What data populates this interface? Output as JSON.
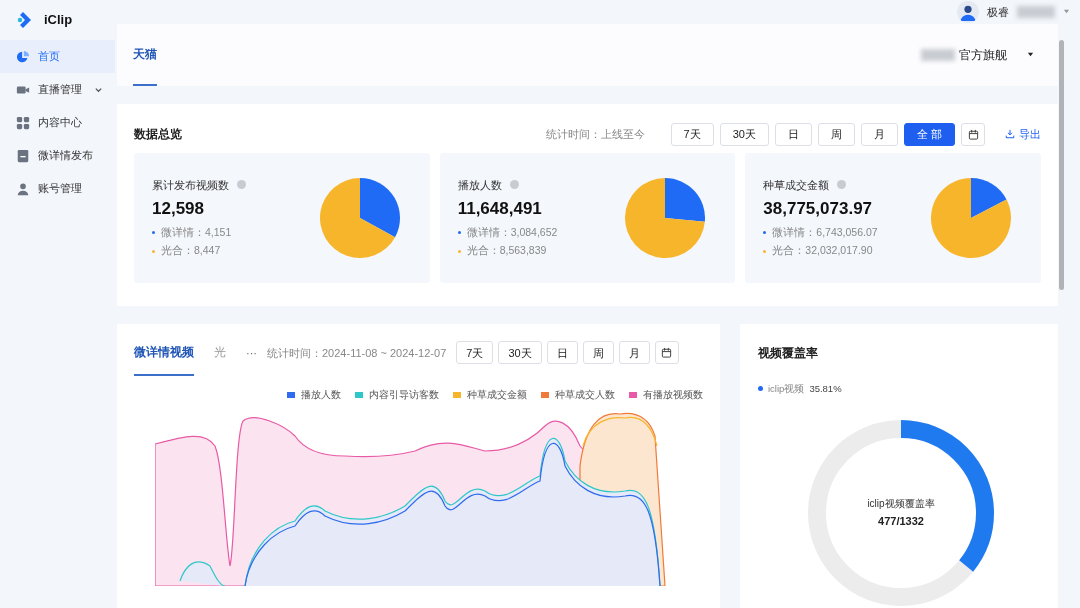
{
  "app": {
    "name": "iClip"
  },
  "user": {
    "name": "极睿"
  },
  "sidebar": {
    "items": [
      {
        "label": "首页",
        "selected": true
      },
      {
        "label": "直播管理",
        "selected": false,
        "expanded": false
      },
      {
        "label": "内容中心",
        "selected": false
      },
      {
        "label": "微详情发布",
        "selected": false
      },
      {
        "label": "账号管理",
        "selected": false
      }
    ]
  },
  "platform_tabs": [
    {
      "label": "天猫",
      "selected": true
    }
  ],
  "store_select": {
    "value": "官方旗舰"
  },
  "overview": {
    "title": "数据总览",
    "stat_time": "统计时间：上线至今",
    "ranges": [
      {
        "label": "7天",
        "selected": false
      },
      {
        "label": "30天",
        "selected": false
      },
      {
        "label": "日",
        "selected": false
      },
      {
        "label": "周",
        "selected": false
      },
      {
        "label": "月",
        "selected": false
      },
      {
        "label": "全 部",
        "selected": true
      }
    ],
    "export": "导出",
    "cards": [
      {
        "title": "累计发布视频数",
        "total": "12,598",
        "lines": [
          "微详情：4,151",
          "光合：8,447"
        ],
        "chart_data": {
          "type": "pie",
          "values": [
            32.95,
            67.05
          ]
        }
      },
      {
        "title": "播放人数",
        "total": "11,648,491",
        "lines": [
          "微详情：3,084,652",
          "光合：8,563,839"
        ],
        "chart_data": {
          "type": "pie",
          "values": [
            26.48,
            73.52
          ]
        }
      },
      {
        "title": "种草成交金额",
        "total": "38,775,073.97",
        "lines": [
          "微详情：6,743,056.07",
          "光合：32,032,017.90"
        ],
        "chart_data": {
          "type": "pie",
          "values": [
            17.39,
            82.61
          ]
        }
      }
    ]
  },
  "trend": {
    "tabs": [
      {
        "label": "微详情视频",
        "selected": true
      },
      {
        "label": "光",
        "selected": false
      }
    ],
    "more": "···",
    "stat_time": "统计时间：2024-11-08 ~ 2024-12-07",
    "ranges": [
      {
        "label": "7天",
        "selected": false
      },
      {
        "label": "30天",
        "selected": false
      },
      {
        "label": "日",
        "selected": false
      },
      {
        "label": "周",
        "selected": false
      },
      {
        "label": "月",
        "selected": false
      }
    ],
    "legend": [
      {
        "label": "播放人数",
        "color": "#2f6bef"
      },
      {
        "label": "内容引导访客数",
        "color": "#2ec7c9"
      },
      {
        "label": "种草成交金额",
        "color": "#f7b52c"
      },
      {
        "label": "种草成交人数",
        "color": "#f07a3a"
      },
      {
        "label": "有播放视频数",
        "color": "#e85aa5"
      }
    ]
  },
  "coverage": {
    "title": "视频覆盖率",
    "legend": "iclip视频",
    "percent": "35.81%",
    "center_label": "iclip视频覆盖率",
    "center_value": "477/1332",
    "level": 0.3581
  }
}
